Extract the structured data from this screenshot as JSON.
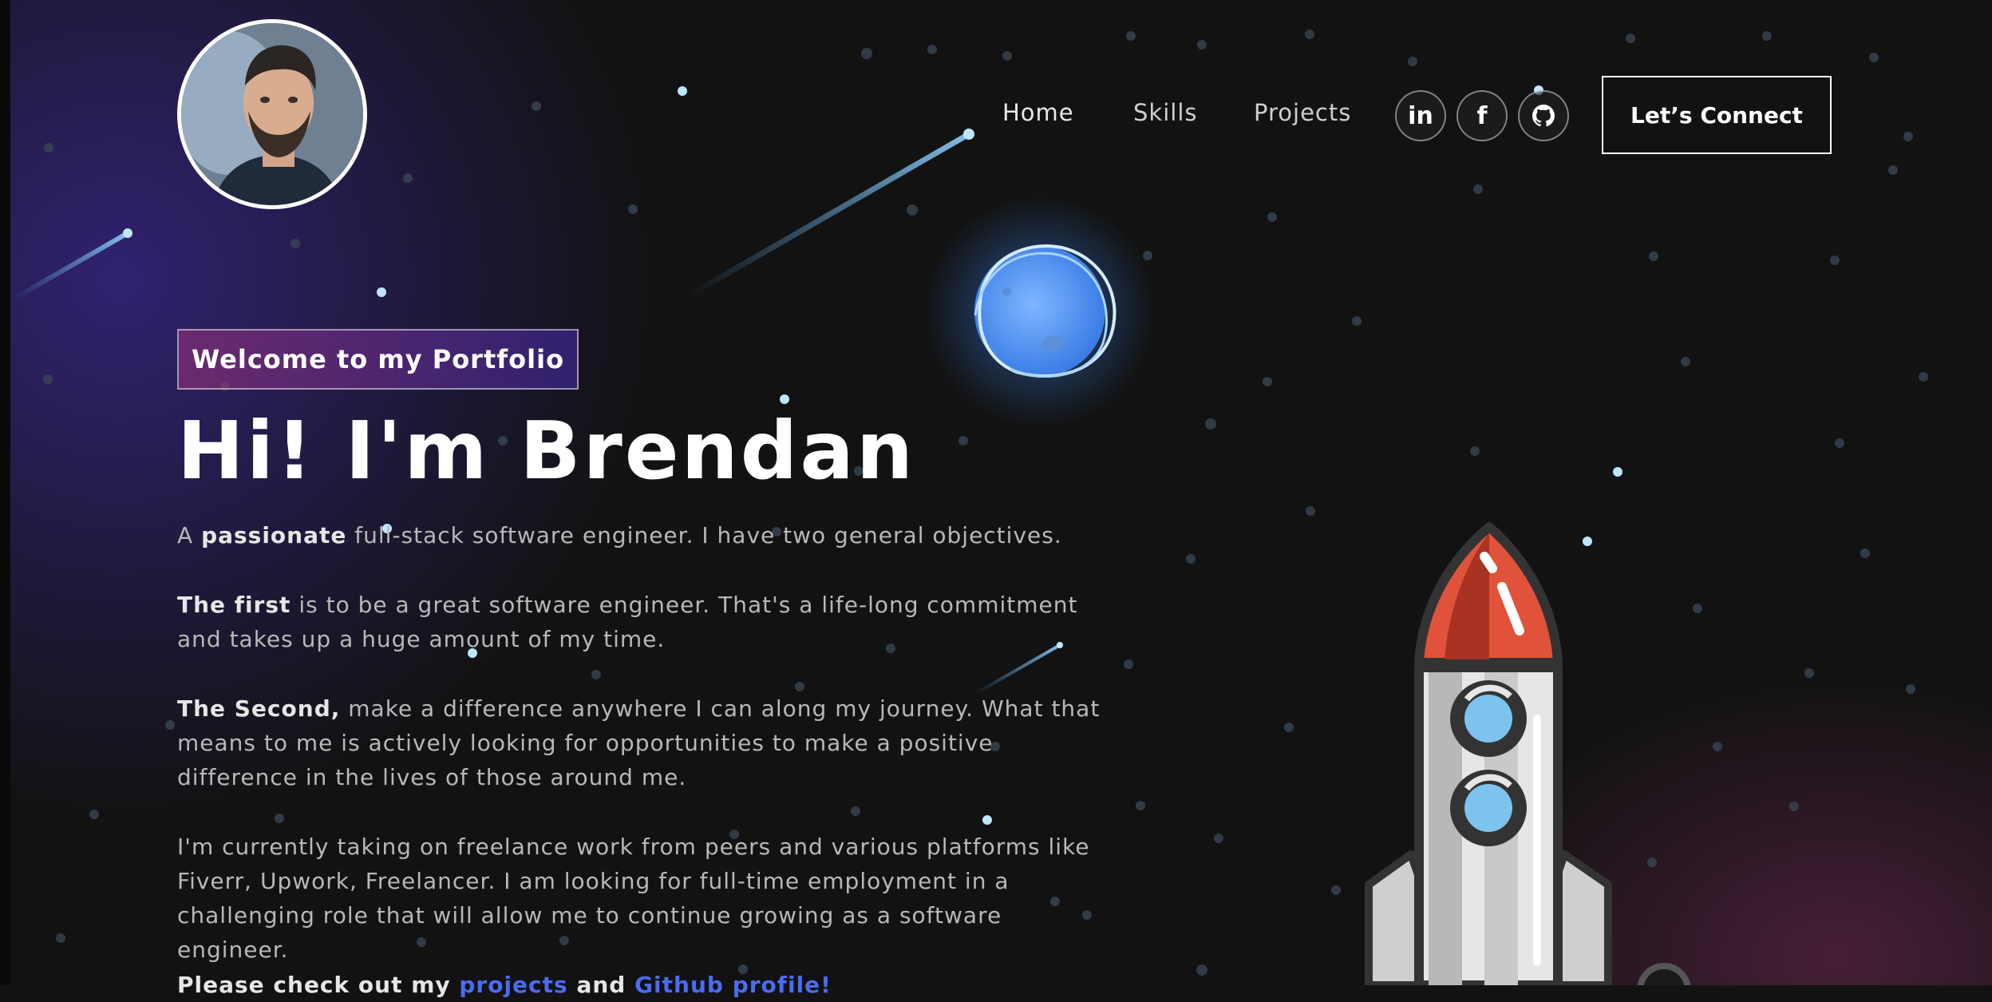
{
  "header": {
    "avatar_label": "Brendan profile photo",
    "nav": [
      {
        "label": "Home"
      },
      {
        "label": "Skills"
      },
      {
        "label": "Projects"
      }
    ],
    "social": [
      {
        "icon": "linkedin-icon"
      },
      {
        "icon": "facebook-icon"
      },
      {
        "icon": "github-icon"
      }
    ],
    "connect_label": "Let’s Connect"
  },
  "hero": {
    "tagline": "Welcome to my Portfolio",
    "title": "Hi! I'm Brendan",
    "intro": {
      "prefix": "A ",
      "bold": "passionate",
      "suffix": " full-stack software engineer. I have two general objectives."
    },
    "first": {
      "bold": "The first",
      "text": " is to be a great software engineer. That's a life-long commitment and takes up a huge amount of my time."
    },
    "second": {
      "bold": "The Second,",
      "text": " make a difference anywhere I can along my journey. What that means to me is actively looking for opportunities to make a positive difference in the lives of those around me."
    },
    "freelance": "I'm currently taking on freelance work from peers and various platforms like Fiverr, Upwork, Freelancer. I am looking for full-time employment in a challenging role that will allow me to continue growing as a software engineer.",
    "cta": {
      "prefix": "Please check out my ",
      "link1": "projects",
      "middle": " and ",
      "link2": "Github profile!"
    }
  },
  "colors": {
    "background": "#121212",
    "link": "#4a6cf0",
    "purple": "#4a2fbd",
    "pink": "#aa367c",
    "rocket_nose": "#e0533a",
    "rocket_window": "#7cc4ee"
  }
}
